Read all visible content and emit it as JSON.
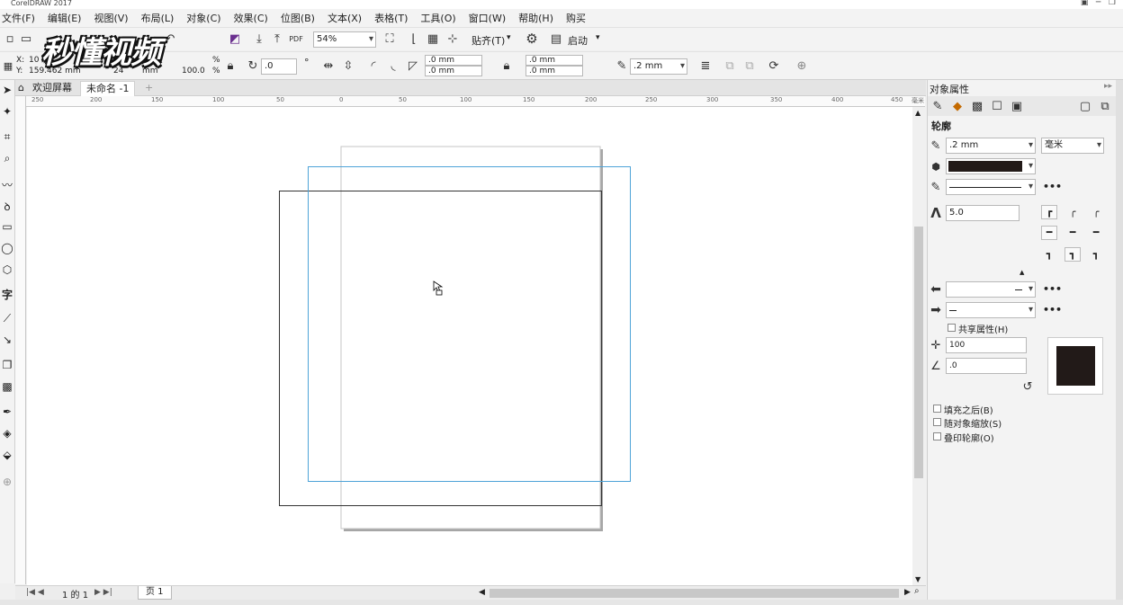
{
  "app": {
    "title": "CorelDRAW 2017"
  },
  "menu": [
    "文件(F)",
    "编辑(E)",
    "视图(V)",
    "布局(L)",
    "对象(C)",
    "效果(C)",
    "位图(B)",
    "文本(X)",
    "表格(T)",
    "工具(O)",
    "窗口(W)",
    "帮助(H)",
    "购买"
  ],
  "toolbar1": {
    "zoom": "54%",
    "snap": "贴齐(T)",
    "launch": "启动"
  },
  "toolbar2": {
    "x_label": "X:",
    "x_value": "10",
    "y_label": "Y:",
    "y_value": "159.462 mm",
    "h_value": "24",
    "h_unit": "mm",
    "scale": "100.0",
    "percent": "%",
    "rotation": ".0",
    "degree": "°",
    "corner1": ".0 mm",
    "corner2": ".0 mm",
    "corner3": ".0 mm",
    "corner4": ".0 mm",
    "outline_width": ".2 mm"
  },
  "tabs": {
    "welcome": "欢迎屏幕",
    "doc": "未命名 -1",
    "add": "+"
  },
  "ruler_h": [
    "250",
    "200",
    "150",
    "100",
    "50",
    "0",
    "50",
    "100",
    "150",
    "200",
    "250",
    "300",
    "350",
    "400",
    "450"
  ],
  "ruler_unit": "毫米",
  "bottom": {
    "page_of": "1 的 1",
    "page_tab": "页 1"
  },
  "docker": {
    "title": "对象属性",
    "section": "轮廓",
    "width": ".2 mm",
    "unit": "毫米",
    "miter": "5.0",
    "share": "共享属性(H)",
    "stretch": "100",
    "angle": ".0",
    "fill_behind": "填充之后(B)",
    "scale_with": "随对象缩放(S)",
    "overprint": "叠印轮廓(O)",
    "outline_color": "#221a18"
  },
  "watermark": "秒懂视频"
}
